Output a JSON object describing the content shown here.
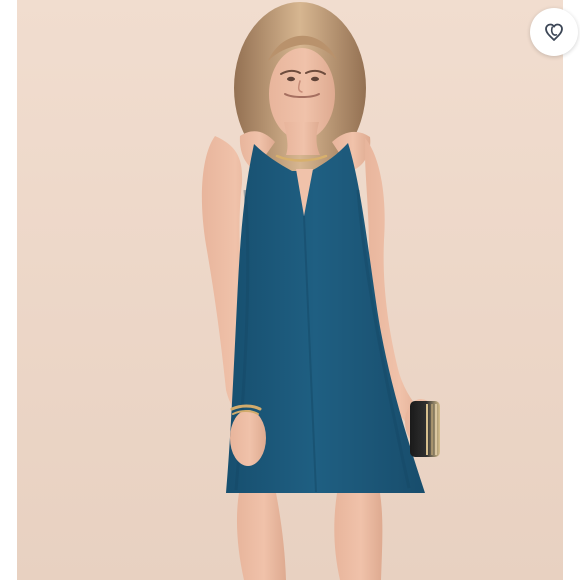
{
  "listing": {
    "photo": {
      "subject_icon": "dress-photo-icon",
      "background_color": "#efd8c9",
      "dress_color": "#1f5f82"
    },
    "like_button": {
      "icon": "heart-icon",
      "accent_color": "#3c4656"
    }
  }
}
